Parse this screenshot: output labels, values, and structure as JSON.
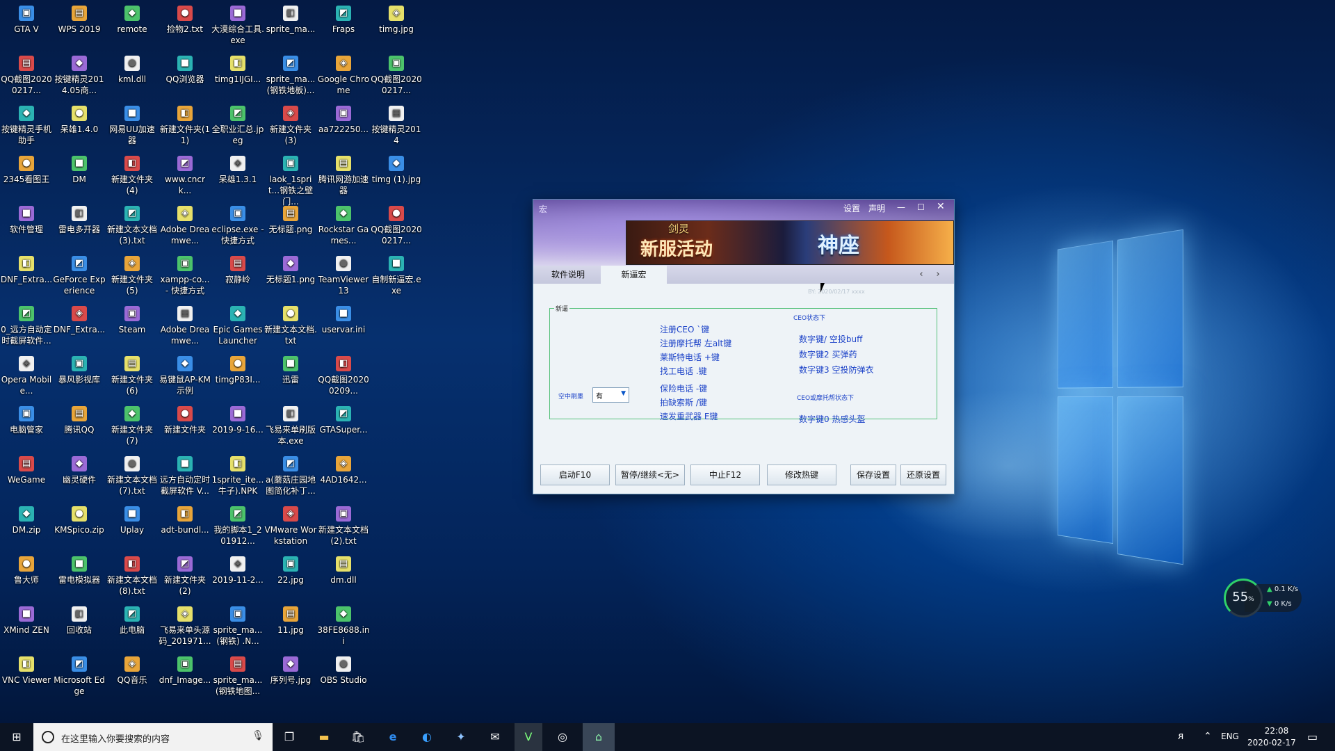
{
  "desktop": {
    "icons": [
      [
        "GTA V",
        "WPS 2019",
        "remote",
        "捡物2.txt",
        "大漠综合工具.exe",
        "sprite_ma...",
        "Fraps",
        "timg.jpg"
      ],
      [
        "QQ截图20200217...",
        "按键精灵2014.05商...",
        "kml.dll",
        "QQ浏览器",
        "timg1IJGI...",
        "sprite_ma...(钢铁地板)...",
        "Google Chrome",
        "QQ截图20200217..."
      ],
      [
        "按键精灵手机助手",
        "呆雄1.4.0",
        "网易UU加速器",
        "新建文件夹(11)",
        "全职业汇总.jpeg",
        "新建文件夹(3)",
        "aa722250...",
        "按键精灵2014"
      ],
      [
        "2345看图王",
        "DM",
        "新建文件夹(4)",
        "www.cncrk...",
        "呆雄1.3.1",
        "laok_1sprit...钢铁之壁门...",
        "腾讯网游加速器",
        "timg (1).jpg"
      ],
      [
        "软件管理",
        "雷电多开器",
        "新建文本文档(3).txt",
        "Adobe Dreamwe...",
        "eclipse.exe - 快捷方式",
        "无标题.png",
        "Rockstar Games...",
        "QQ截图20200217..."
      ],
      [
        "DNF_Extra...",
        "GeForce Experience",
        "新建文件夹(5)",
        "xampp-co... - 快捷方式",
        "寂静岭",
        "无标题1.png",
        "TeamViewer 13",
        "自制新逼宏.exe"
      ],
      [
        "0_远方自动定时截屏软件...",
        "DNF_Extra...",
        "Steam",
        "Adobe Dreamwe...",
        "Epic Games Launcher",
        "新建文本文档.txt",
        "uservar.ini",
        ""
      ],
      [
        "Opera Mobile...",
        "暴风影视库",
        "新建文件夹(6)",
        "易键鼠AP-KM示例",
        "timgP83I...",
        "迅雷",
        "QQ截图20200209...",
        ""
      ],
      [
        "电脑管家",
        "腾讯QQ",
        "新建文件夹(7)",
        "新建文件夹",
        "2019-9-16...",
        "飞易来单刷版本.exe",
        "GTASuper...",
        ""
      ],
      [
        "WeGame",
        "幽灵硬件",
        "新建文本文档(7).txt",
        "远方自动定时截屏软件 V...",
        "1sprite_ite...牛子).NPK",
        "a(蘑菇庄园地图简化补丁...",
        "4AD1642...",
        ""
      ],
      [
        "DM.zip",
        "KMSpico.zip",
        "Uplay",
        "adt-bundl...",
        "我的脚本1_201912...",
        "VMware Workstation",
        "新建文本文档(2).txt",
        ""
      ],
      [
        "鲁大师",
        "雷电模拟器",
        "新建文本文档(8).txt",
        "新建文件夹(2)",
        "2019-11-2...",
        "22.jpg",
        "dm.dll",
        ""
      ],
      [
        "XMind ZEN",
        "回收站",
        "此电脑",
        "飞易来单头源码_201971...",
        "sprite_ma...(钢铁) .N...",
        "11.jpg",
        "38FE8688.ini",
        ""
      ],
      [
        "VNC Viewer",
        "Microsoft Edge",
        "QQ音乐",
        "dnf_Image...",
        "sprite_ma...(钢铁地图...",
        "序列号.jpg",
        "OBS Studio",
        ""
      ]
    ]
  },
  "window": {
    "title": "宏",
    "settings_label": "设置",
    "statement_label": "声明",
    "ad_tag": "剑灵",
    "ad_text": "新服活动",
    "ad_text2": "神座",
    "tabs": [
      "软件说明",
      "新逼宏"
    ],
    "faint_text": "BY: 2020/02/17 xxxx",
    "group_title": "新逼",
    "lines_left": [
      "注册CEO `键",
      "注册摩托帮 左alt键",
      "莱斯特电话 +键",
      "找工电话 .键",
      "保险电话 -键",
      "拍缺索斯 /键",
      "速发重武器 E键"
    ],
    "ceo_header": "CEO状态下",
    "ceo_lines": [
      "数字键/ 空投buff",
      "数字键2 买弹药",
      "数字键3 空投防弹衣"
    ],
    "biker_header": "CEO或摩托帮状态下",
    "biker_line": "数字键0 热感头盔",
    "select_label": "空中刷墨",
    "select_value": "有",
    "buttons": [
      "启动F10",
      "暂停/继续<无>",
      "中止F12",
      "修改热键",
      "保存设置",
      "还原设置"
    ]
  },
  "taskbar": {
    "search_placeholder": "在这里输入你要搜索的内容",
    "lang": "ENG",
    "time": "22:08",
    "date": "2020-02-17"
  },
  "widget": {
    "percent": "55",
    "percent_unit": "%",
    "up": "0.1 K/s",
    "down": "0 K/s"
  }
}
